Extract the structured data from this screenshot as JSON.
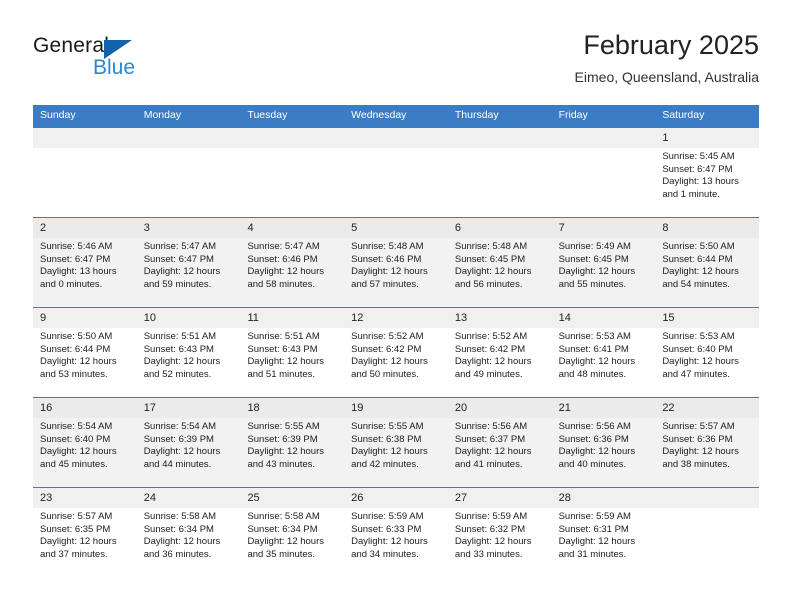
{
  "brand": {
    "name_part1": "General",
    "name_part2": "Blue",
    "triangle_color": "#1263ac",
    "blue_color": "#2a86d8"
  },
  "header": {
    "title": "February 2025",
    "subtitle": "Eimeo, Queensland, Australia"
  },
  "theme": {
    "header_blue": "#3a7dc4",
    "row_shade": "#f2f2f2",
    "day_number_band": "#f0f0f0"
  },
  "weekdays": [
    "Sunday",
    "Monday",
    "Tuesday",
    "Wednesday",
    "Thursday",
    "Friday",
    "Saturday"
  ],
  "weeks": [
    {
      "shaded": false,
      "days": [
        {
          "empty": true
        },
        {
          "empty": true
        },
        {
          "empty": true
        },
        {
          "empty": true
        },
        {
          "empty": true
        },
        {
          "empty": true
        },
        {
          "number": "1",
          "sunrise": "Sunrise: 5:45 AM",
          "sunset": "Sunset: 6:47 PM",
          "daylight": "Daylight: 13 hours and 1 minute."
        }
      ]
    },
    {
      "shaded": true,
      "days": [
        {
          "number": "2",
          "sunrise": "Sunrise: 5:46 AM",
          "sunset": "Sunset: 6:47 PM",
          "daylight": "Daylight: 13 hours and 0 minutes."
        },
        {
          "number": "3",
          "sunrise": "Sunrise: 5:47 AM",
          "sunset": "Sunset: 6:47 PM",
          "daylight": "Daylight: 12 hours and 59 minutes."
        },
        {
          "number": "4",
          "sunrise": "Sunrise: 5:47 AM",
          "sunset": "Sunset: 6:46 PM",
          "daylight": "Daylight: 12 hours and 58 minutes."
        },
        {
          "number": "5",
          "sunrise": "Sunrise: 5:48 AM",
          "sunset": "Sunset: 6:46 PM",
          "daylight": "Daylight: 12 hours and 57 minutes."
        },
        {
          "number": "6",
          "sunrise": "Sunrise: 5:48 AM",
          "sunset": "Sunset: 6:45 PM",
          "daylight": "Daylight: 12 hours and 56 minutes."
        },
        {
          "number": "7",
          "sunrise": "Sunrise: 5:49 AM",
          "sunset": "Sunset: 6:45 PM",
          "daylight": "Daylight: 12 hours and 55 minutes."
        },
        {
          "number": "8",
          "sunrise": "Sunrise: 5:50 AM",
          "sunset": "Sunset: 6:44 PM",
          "daylight": "Daylight: 12 hours and 54 minutes."
        }
      ]
    },
    {
      "shaded": false,
      "days": [
        {
          "number": "9",
          "sunrise": "Sunrise: 5:50 AM",
          "sunset": "Sunset: 6:44 PM",
          "daylight": "Daylight: 12 hours and 53 minutes."
        },
        {
          "number": "10",
          "sunrise": "Sunrise: 5:51 AM",
          "sunset": "Sunset: 6:43 PM",
          "daylight": "Daylight: 12 hours and 52 minutes."
        },
        {
          "number": "11",
          "sunrise": "Sunrise: 5:51 AM",
          "sunset": "Sunset: 6:43 PM",
          "daylight": "Daylight: 12 hours and 51 minutes."
        },
        {
          "number": "12",
          "sunrise": "Sunrise: 5:52 AM",
          "sunset": "Sunset: 6:42 PM",
          "daylight": "Daylight: 12 hours and 50 minutes."
        },
        {
          "number": "13",
          "sunrise": "Sunrise: 5:52 AM",
          "sunset": "Sunset: 6:42 PM",
          "daylight": "Daylight: 12 hours and 49 minutes."
        },
        {
          "number": "14",
          "sunrise": "Sunrise: 5:53 AM",
          "sunset": "Sunset: 6:41 PM",
          "daylight": "Daylight: 12 hours and 48 minutes."
        },
        {
          "number": "15",
          "sunrise": "Sunrise: 5:53 AM",
          "sunset": "Sunset: 6:40 PM",
          "daylight": "Daylight: 12 hours and 47 minutes."
        }
      ]
    },
    {
      "shaded": true,
      "days": [
        {
          "number": "16",
          "sunrise": "Sunrise: 5:54 AM",
          "sunset": "Sunset: 6:40 PM",
          "daylight": "Daylight: 12 hours and 45 minutes."
        },
        {
          "number": "17",
          "sunrise": "Sunrise: 5:54 AM",
          "sunset": "Sunset: 6:39 PM",
          "daylight": "Daylight: 12 hours and 44 minutes."
        },
        {
          "number": "18",
          "sunrise": "Sunrise: 5:55 AM",
          "sunset": "Sunset: 6:39 PM",
          "daylight": "Daylight: 12 hours and 43 minutes."
        },
        {
          "number": "19",
          "sunrise": "Sunrise: 5:55 AM",
          "sunset": "Sunset: 6:38 PM",
          "daylight": "Daylight: 12 hours and 42 minutes."
        },
        {
          "number": "20",
          "sunrise": "Sunrise: 5:56 AM",
          "sunset": "Sunset: 6:37 PM",
          "daylight": "Daylight: 12 hours and 41 minutes."
        },
        {
          "number": "21",
          "sunrise": "Sunrise: 5:56 AM",
          "sunset": "Sunset: 6:36 PM",
          "daylight": "Daylight: 12 hours and 40 minutes."
        },
        {
          "number": "22",
          "sunrise": "Sunrise: 5:57 AM",
          "sunset": "Sunset: 6:36 PM",
          "daylight": "Daylight: 12 hours and 38 minutes."
        }
      ]
    },
    {
      "shaded": false,
      "days": [
        {
          "number": "23",
          "sunrise": "Sunrise: 5:57 AM",
          "sunset": "Sunset: 6:35 PM",
          "daylight": "Daylight: 12 hours and 37 minutes."
        },
        {
          "number": "24",
          "sunrise": "Sunrise: 5:58 AM",
          "sunset": "Sunset: 6:34 PM",
          "daylight": "Daylight: 12 hours and 36 minutes."
        },
        {
          "number": "25",
          "sunrise": "Sunrise: 5:58 AM",
          "sunset": "Sunset: 6:34 PM",
          "daylight": "Daylight: 12 hours and 35 minutes."
        },
        {
          "number": "26",
          "sunrise": "Sunrise: 5:59 AM",
          "sunset": "Sunset: 6:33 PM",
          "daylight": "Daylight: 12 hours and 34 minutes."
        },
        {
          "number": "27",
          "sunrise": "Sunrise: 5:59 AM",
          "sunset": "Sunset: 6:32 PM",
          "daylight": "Daylight: 12 hours and 33 minutes."
        },
        {
          "number": "28",
          "sunrise": "Sunrise: 5:59 AM",
          "sunset": "Sunset: 6:31 PM",
          "daylight": "Daylight: 12 hours and 31 minutes."
        },
        {
          "empty": true
        }
      ]
    }
  ]
}
